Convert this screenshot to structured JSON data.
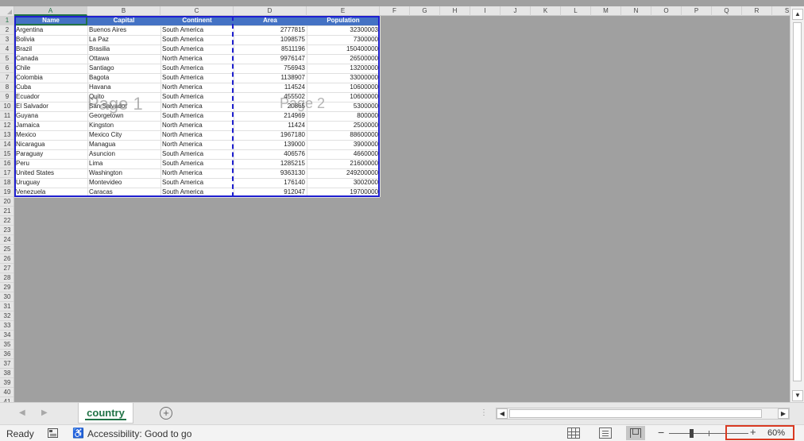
{
  "columns": [
    "A",
    "B",
    "C",
    "D",
    "E",
    "F",
    "G",
    "H",
    "I",
    "J",
    "K",
    "L",
    "M",
    "N",
    "O",
    "P",
    "Q",
    "R",
    "S"
  ],
  "rows": [
    "1",
    "2",
    "3",
    "4",
    "5",
    "6",
    "7",
    "8",
    "9",
    "10",
    "11",
    "12",
    "13",
    "14",
    "15",
    "16",
    "17",
    "18",
    "19",
    "20",
    "21",
    "22",
    "23",
    "24",
    "25",
    "26",
    "27",
    "28",
    "29",
    "30",
    "31",
    "32",
    "33",
    "34",
    "35",
    "36",
    "37",
    "38",
    "39",
    "40",
    "41"
  ],
  "table": {
    "headers": [
      "Name",
      "Capital",
      "Continent",
      "Area",
      "Population"
    ],
    "rows": [
      [
        "Argentina",
        "Buenos Aires",
        "South America",
        "2777815",
        "32300003"
      ],
      [
        "Bolivia",
        "La Paz",
        "South America",
        "1098575",
        "7300000"
      ],
      [
        "Brazil",
        "Brasilia",
        "South America",
        "8511196",
        "150400000"
      ],
      [
        "Canada",
        "Ottawa",
        "North America",
        "9976147",
        "26500000"
      ],
      [
        "Chile",
        "Santiago",
        "South America",
        "756943",
        "13200000"
      ],
      [
        "Colombia",
        "Bagota",
        "South America",
        "1138907",
        "33000000"
      ],
      [
        "Cuba",
        "Havana",
        "North America",
        "114524",
        "10600000"
      ],
      [
        "Ecuador",
        "Quito",
        "South America",
        "455502",
        "10600000"
      ],
      [
        "El Salvador",
        "San Salvador",
        "North America",
        "20865",
        "5300000"
      ],
      [
        "Guyana",
        "Georgetown",
        "South America",
        "214969",
        "800000"
      ],
      [
        "Jamaica",
        "Kingston",
        "North America",
        "11424",
        "2500000"
      ],
      [
        "Mexico",
        "Mexico City",
        "North America",
        "1967180",
        "88600000"
      ],
      [
        "Nicaragua",
        "Managua",
        "North America",
        "139000",
        "3900000"
      ],
      [
        "Paraguay",
        "Asuncion",
        "South America",
        "406576",
        "4660000"
      ],
      [
        "Peru",
        "Lima",
        "South America",
        "1285215",
        "21600000"
      ],
      [
        "United States",
        "Washington",
        "North America",
        "9363130",
        "249200000"
      ],
      [
        "Uruguay",
        "Montevideo",
        "South America",
        "176140",
        "3002000"
      ],
      [
        "Venezuela",
        "Caracas",
        "South America",
        "912047",
        "19700000"
      ]
    ]
  },
  "watermarks": {
    "page1": "Page 1",
    "page2": "Page 2"
  },
  "sheet_tab": {
    "label": "country"
  },
  "add_sheet": {
    "label": "+"
  },
  "status": {
    "ready": "Ready",
    "accessibility": "Accessibility: Good to go",
    "zoom_minus": "−",
    "zoom_plus": "+",
    "zoom_level": "60%"
  },
  "colors": {
    "header_fill": "#4472c4",
    "page_border": "#1f1fd0",
    "accent": "#217346",
    "highlight": "#d93a22"
  },
  "icons": [
    "macro-recording-icon",
    "accessibility-icon",
    "normal-view-icon",
    "page-layout-view-icon",
    "page-break-preview-icon",
    "scroll-up-icon",
    "scroll-down-icon",
    "scroll-left-icon",
    "scroll-right-icon"
  ]
}
